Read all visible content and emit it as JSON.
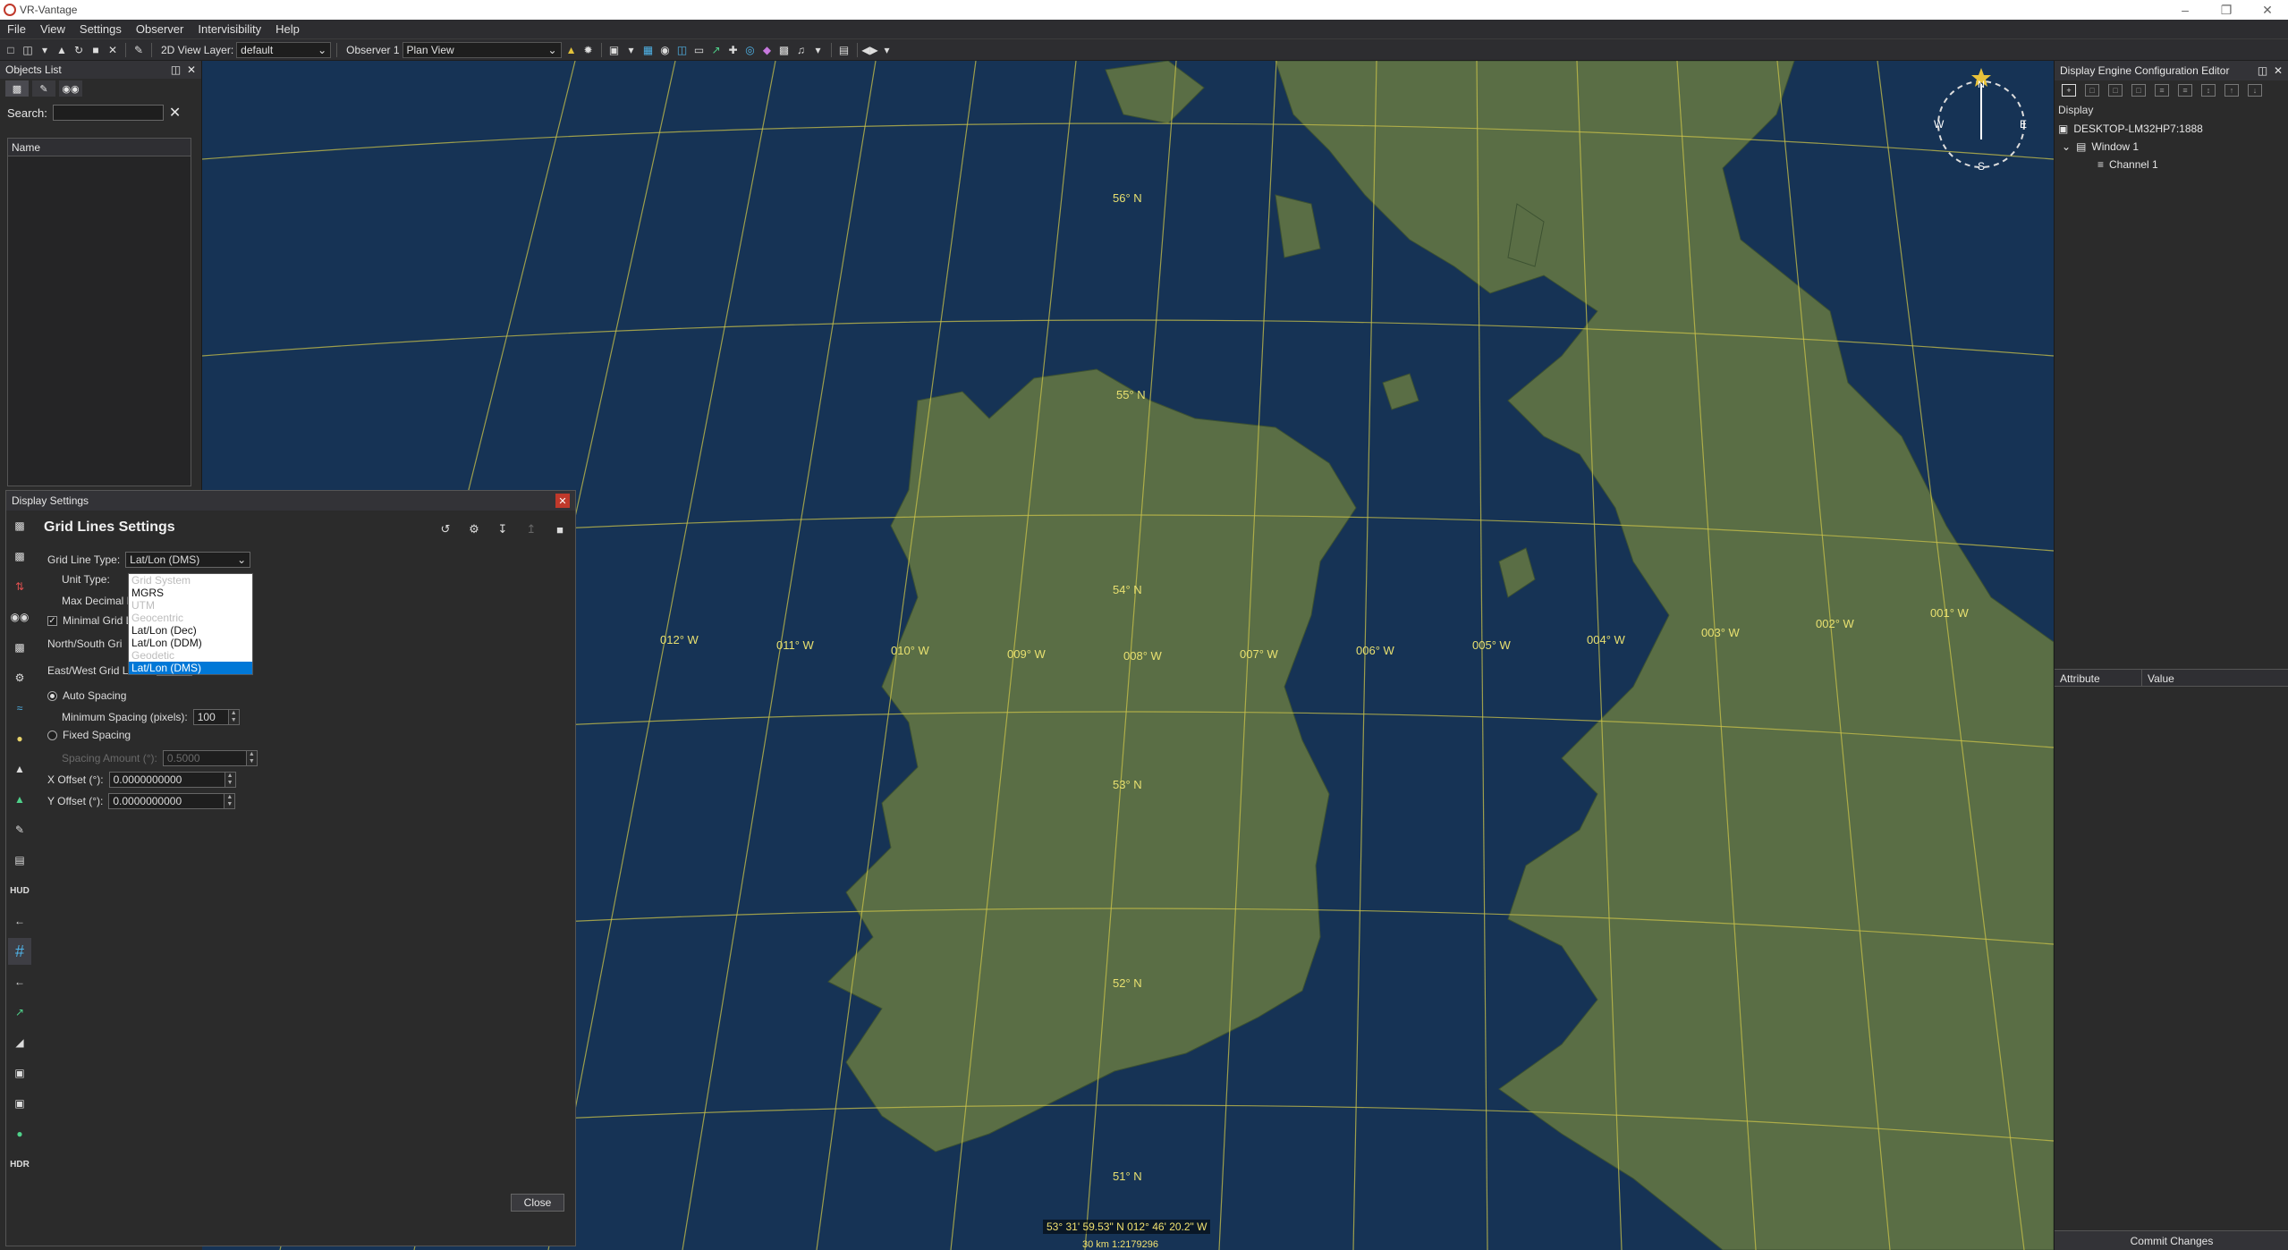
{
  "window": {
    "title": "VR-Vantage"
  },
  "menu": [
    "File",
    "View",
    "Settings",
    "Observer",
    "Intervisibility",
    "Help"
  ],
  "toolbar": {
    "view_layer_label": "2D View Layer:",
    "view_layer_value": "default",
    "observer_label": "Observer 1",
    "observer_value": "Plan View"
  },
  "objects_list": {
    "title": "Objects List",
    "search_label": "Search:",
    "search_value": "",
    "column_name": "Name"
  },
  "map": {
    "latitude_labels": [
      "56° N",
      "55° N",
      "54° N",
      "53° N",
      "52° N",
      "51° N"
    ],
    "longitude_labels": [
      "012° W",
      "011° W",
      "010° W",
      "009° W",
      "008° W",
      "007° W",
      "006° W",
      "005° W",
      "004° W",
      "003° W",
      "002° W",
      "001° W"
    ],
    "coordinates": "53° 31' 59.53\" N  012° 46' 20.2\" W",
    "scale": "30 km    1:2179296",
    "compass": {
      "n": "N",
      "e": "E",
      "s": "S",
      "w": "W"
    },
    "colors": {
      "sea": "#163355",
      "land": "#5a6e45",
      "grid": "#c9c24a"
    }
  },
  "config_editor": {
    "title": "Display Engine Configuration Editor",
    "section": "Display",
    "tree": [
      "DESKTOP-LM32HP7:1888",
      "Window 1",
      "Channel 1"
    ],
    "attr_col": "Attribute",
    "value_col": "Value",
    "commit": "Commit Changes"
  },
  "display_settings": {
    "title": "Display Settings",
    "heading": "Grid Lines Settings",
    "grid_line_type_label": "Grid Line Type:",
    "grid_line_type_value": "Lat/Lon (DMS)",
    "unit_type_label": "Unit Type:",
    "max_decimal_label": "Max Decimal P",
    "minimal_grid_label": "Minimal Grid L",
    "north_south_label": "North/South Gri",
    "east_west_label": "East/West Grid Lines:",
    "auto_spacing_label": "Auto Spacing",
    "min_spacing_label": "Minimum Spacing (pixels):",
    "min_spacing_value": "100",
    "fixed_spacing_label": "Fixed Spacing",
    "spacing_amount_label": "Spacing Amount (°):",
    "spacing_amount_value": "0.5000",
    "x_offset_label": "X Offset (°):",
    "x_offset_value": "0.0000000000",
    "y_offset_label": "Y Offset (°):",
    "y_offset_value": "0.0000000000",
    "dropdown_options": [
      {
        "label": "Grid System",
        "enabled": false
      },
      {
        "label": "MGRS",
        "enabled": true
      },
      {
        "label": "UTM",
        "enabled": false
      },
      {
        "label": "Geocentric",
        "enabled": false
      },
      {
        "label": "Lat/Lon (Dec)",
        "enabled": true
      },
      {
        "label": "Lat/Lon (DDM)",
        "enabled": true
      },
      {
        "label": "Geodetic",
        "enabled": false
      },
      {
        "label": "Lat/Lon (DMS)",
        "enabled": true,
        "selected": true
      }
    ],
    "sidebar_icons": [
      "vehicle-icon",
      "car-icon",
      "road-icon",
      "binoculars-icon",
      "truck-icon",
      "gear-icon",
      "waves-icon",
      "light-icon",
      "person-icon",
      "terrain-icon",
      "tag-icon",
      "layers-icon",
      "HUD",
      "arrow-icon",
      "grid-icon",
      "back-arrow-icon",
      "line-icon",
      "ruler-icon",
      "scan-icon",
      "camera-icon",
      "globe-icon",
      "HDR"
    ],
    "close_label": "Close"
  }
}
